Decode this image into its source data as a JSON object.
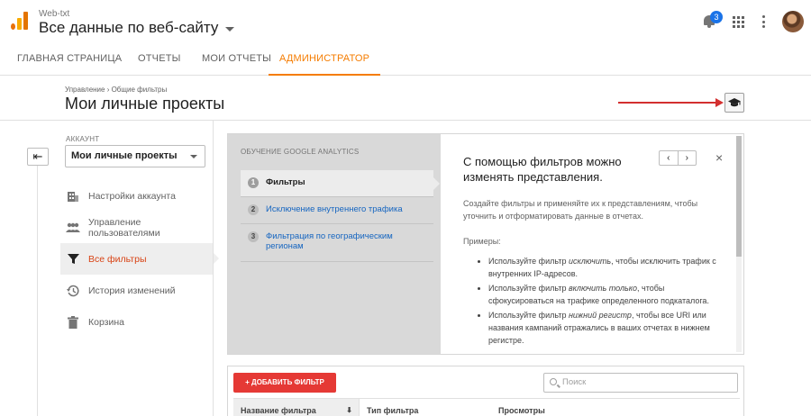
{
  "header": {
    "account_small": "Web-txt",
    "account_title": "Все данные по веб-сайту",
    "notifications_count": "3",
    "icons": [
      "analytics-logo-icon",
      "bell-icon",
      "apps-grid-icon",
      "more-vert-icon",
      "avatar"
    ]
  },
  "nav": {
    "tabs": [
      {
        "label": "ГЛАВНАЯ СТРАНИЦА"
      },
      {
        "label": "ОТЧЕТЫ"
      },
      {
        "label": "МОИ ОТЧЕТЫ"
      },
      {
        "label": "АДМИНИСТРАТОР"
      }
    ],
    "active_index": 3
  },
  "page": {
    "breadcrumb": "Управление › Общие фильтры",
    "title": "Мои личные проекты"
  },
  "sidebar": {
    "account_label": "АККАУНТ",
    "account_value": "Мои личные проекты",
    "items": [
      {
        "label": "Настройки аккаунта",
        "icon": "building-icon"
      },
      {
        "label": "Управление пользователями",
        "icon": "people-icon"
      },
      {
        "label": "Все фильтры",
        "icon": "filter-icon",
        "active": true
      },
      {
        "label": "История изменений",
        "icon": "history-icon"
      },
      {
        "label": "Корзина",
        "icon": "trash-icon"
      }
    ]
  },
  "tutorial": {
    "heading": "ОБУЧЕНИЕ GOOGLE ANALYTICS",
    "steps": [
      {
        "num": "1",
        "label": "Фильтры"
      },
      {
        "num": "2",
        "label": "Исключение внутреннего трафика"
      },
      {
        "num": "3",
        "label": "Фильтрация по географическим регионам"
      }
    ],
    "title": "С помощью фильтров можно изменять представления.",
    "paragraph": "Создайте фильтры и применяйте их к представлениям, чтобы уточнить и отформатировать данные в отчетах.",
    "examples_label": "Примеры:",
    "examples": [
      {
        "pre": "Используйте фильтр ",
        "em": "исключить",
        "post": ", чтобы исключить трафик с внутренних IP-адресов."
      },
      {
        "pre": "Используйте фильтр ",
        "em": "включить только",
        "post": ", чтобы сфокусироваться на трафике определенного подкаталога."
      },
      {
        "pre": "Используйте фильтр ",
        "em": "нижний регистр",
        "post": ", чтобы все URI или названия кампаний отражались в ваших отчетах в нижнем регистре."
      }
    ],
    "prev": "‹",
    "next": "›",
    "close": "×"
  },
  "filters": {
    "add_button": "+ ДОБАВИТЬ ФИЛЬТР",
    "search_placeholder": "Поиск",
    "columns": [
      "Название фильтра",
      "Тип фильтра",
      "Просмотры"
    ],
    "sort_indicator": "⬇"
  },
  "colors": {
    "accent": "#f57c00",
    "active_menu_text": "#d84315",
    "add_button": "#e53935",
    "link": "#1565c0",
    "annotation_arrow": "#d32f2f"
  }
}
